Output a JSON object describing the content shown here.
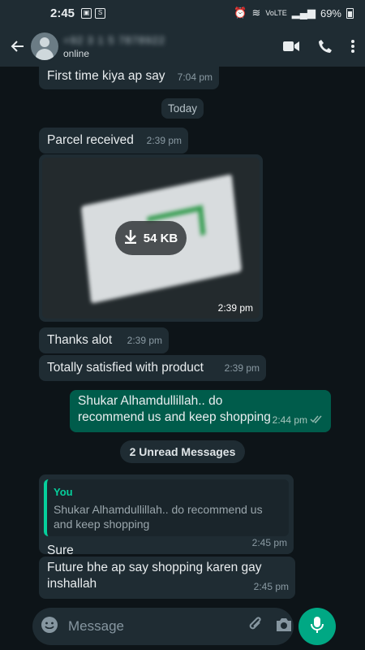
{
  "statusbar": {
    "time": "2:45",
    "battery": "69%",
    "net": "VoLTE"
  },
  "header": {
    "contact_name": "+92 3 1 5 7878922",
    "status": "online"
  },
  "messages": [
    {
      "text": "First time kiya ap say",
      "time": "7:04 pm"
    },
    {
      "text": "Today"
    },
    {
      "text": "Parcel received",
      "time": "2:39 pm"
    },
    {
      "size": "54 KB",
      "time": "2:39 pm"
    },
    {
      "text": "Thanks alot",
      "time": "2:39 pm"
    },
    {
      "text": "Totally satisfied with product",
      "time": "2:39 pm"
    },
    {
      "text": "Shukar Alhamdullillah.. do recommend us and keep shopping",
      "time": "2:44 pm"
    },
    {
      "text": "2 Unread Messages"
    },
    {
      "quote_author": "You",
      "quote_text": "Shukar Alhamdullillah.. do recommend us and keep shopping",
      "text": "Sure",
      "time": "2:45 pm"
    },
    {
      "text": "Future bhe ap say shopping karen gay inshallah",
      "time": "2:45 pm"
    }
  ],
  "composer": {
    "placeholder": "Message"
  },
  "colors": {
    "accent": "#00a884",
    "outgoing_bubble": "#005c4b",
    "incoming_bubble": "#1f2c33",
    "background": "#0d1418"
  },
  "icons": [
    "back-arrow-icon",
    "avatar-icon",
    "video-call-icon",
    "phone-icon",
    "more-vert-icon",
    "download-icon",
    "double-check-icon",
    "emoji-icon",
    "attach-icon",
    "camera-icon",
    "mic-icon"
  ]
}
